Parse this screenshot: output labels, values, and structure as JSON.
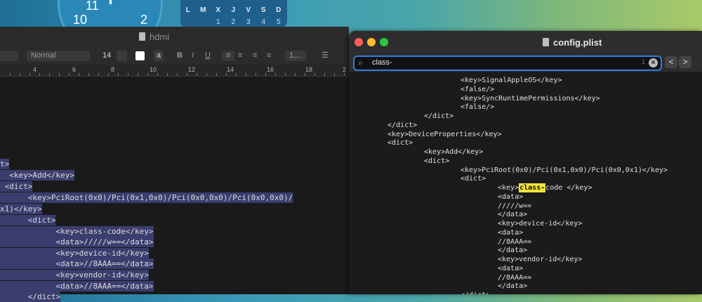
{
  "desktop": {
    "clock": {
      "numbers": [
        "11",
        "10",
        "2"
      ]
    },
    "calendar": {
      "days": [
        "L",
        "M",
        "X",
        "J",
        "V",
        "S",
        "D"
      ],
      "dates": [
        "1",
        "2",
        "3",
        "4",
        "5"
      ]
    }
  },
  "left_window": {
    "title": "hdmi",
    "toolbar": {
      "style": "Normal",
      "size": "14",
      "color_label": "a",
      "bold": "B",
      "italic": "I",
      "underline": "U",
      "spacing": "1,..."
    },
    "ruler": [
      "4",
      "6",
      "8",
      "10",
      "12",
      "14",
      "16",
      "18",
      "2"
    ],
    "lines": [
      {
        "text": "t>",
        "hl": true
      },
      {
        "text": "  <key>Add</key>",
        "hl": true
      },
      {
        "text": " <dict>",
        "hl": true
      },
      {
        "text": "      <key>PciRoot(0x0)/Pci(0x1,0x0)/Pci(0x0,0x0)/Pci(0x0,0x0)/",
        "hl": true
      },
      {
        "text": "x1)</key>",
        "hl": true
      },
      {
        "text": "      <dict>",
        "hl": true
      },
      {
        "text": "            <key>class-code</key>",
        "hl": true
      },
      {
        "text": "            <data>/////w==</data>",
        "hl": true
      },
      {
        "text": "            <key>device-id</key>",
        "hl": true
      },
      {
        "text": "            <data>//8AAA==</data>",
        "hl": true
      },
      {
        "text": "            <key>vendor-id</key>",
        "hl": true
      },
      {
        "text": "            <data>//8AAA==</data>",
        "hl": true
      },
      {
        "text": "      </dict>",
        "hl": true
      }
    ]
  },
  "right_window": {
    "title": "config.plist",
    "search": {
      "value": "class-",
      "count": "1"
    },
    "nav": {
      "prev": "<",
      "next": ">"
    },
    "lines": [
      {
        "indent": 3,
        "text": "<key>SignalAppleOS</key>"
      },
      {
        "indent": 3,
        "text": "<false/>"
      },
      {
        "indent": 3,
        "text": "<key>SyncRuntimePermissions</key>"
      },
      {
        "indent": 3,
        "text": "<false/>"
      },
      {
        "indent": 2,
        "text": "</dict>"
      },
      {
        "indent": 1,
        "text": "</dict>"
      },
      {
        "indent": 1,
        "text": "<key>DeviceProperties</key>"
      },
      {
        "indent": 1,
        "text": "<dict>"
      },
      {
        "indent": 2,
        "text": "<key>Add</key>"
      },
      {
        "indent": 2,
        "text": "<dict>"
      },
      {
        "indent": 3,
        "text": "<key>PciRoot(0x0)/Pci(0x1,0x0)/Pci(0x0,0x1)</key>"
      },
      {
        "indent": 3,
        "text": "<dict>"
      },
      {
        "indent": 4,
        "before": "<key>",
        "match": "class-",
        "after": "code </key>"
      },
      {
        "indent": 4,
        "text": "<data>"
      },
      {
        "indent": 4,
        "text": "/////w=="
      },
      {
        "indent": 4,
        "text": "</data>"
      },
      {
        "indent": 4,
        "text": "<key>device-id</key>"
      },
      {
        "indent": 4,
        "text": "<data>"
      },
      {
        "indent": 4,
        "text": "//8AAA=="
      },
      {
        "indent": 4,
        "text": "</data>"
      },
      {
        "indent": 4,
        "text": "<key>vendor-id</key>"
      },
      {
        "indent": 4,
        "text": "<data>"
      },
      {
        "indent": 4,
        "text": "//8AAA=="
      },
      {
        "indent": 4,
        "text": "</data>"
      },
      {
        "indent": 3,
        "text": "</dict>"
      }
    ]
  }
}
